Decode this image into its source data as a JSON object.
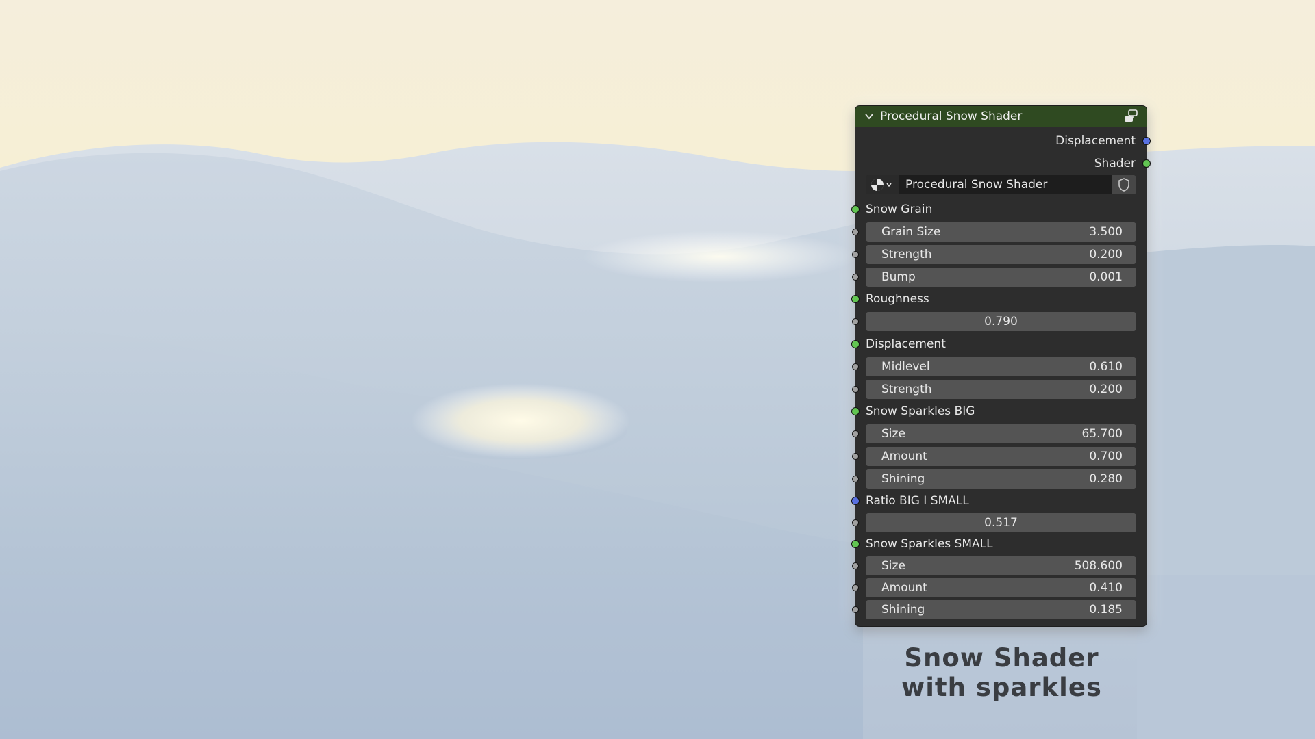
{
  "colors": {
    "header": "#2f4a21",
    "node_body": "#2d2d2d",
    "field": "#545454",
    "socket_green": "#62c552",
    "socket_blue": "#5870e0",
    "socket_grey": "#a1a1a1",
    "caption": "#3a3d42"
  },
  "node": {
    "title": "Procedural Snow Shader",
    "header_icons": [
      "chevron-down-icon",
      "node-group-icon"
    ],
    "outputs": [
      {
        "label": "Displacement",
        "socket": "blue"
      },
      {
        "label": "Shader",
        "socket": "green"
      }
    ],
    "group_selector": {
      "name": "Procedural Snow Shader",
      "icons": [
        "material-sphere-icon",
        "fake-user-shield-icon"
      ]
    },
    "sections": [
      {
        "label": "Snow Grain",
        "socket": "green",
        "fields": [
          {
            "label": "Grain Size",
            "value": "3.500"
          },
          {
            "label": "Strength",
            "value": "0.200"
          },
          {
            "label": "Bump",
            "value": "0.001"
          }
        ]
      },
      {
        "label": "Roughness",
        "socket": "green",
        "fields": [
          {
            "label": "",
            "value": "0.790"
          }
        ]
      },
      {
        "label": "Displacement",
        "socket": "green",
        "fields": [
          {
            "label": "Midlevel",
            "value": "0.610"
          },
          {
            "label": "Strength",
            "value": "0.200"
          }
        ]
      },
      {
        "label": "Snow Sparkles BIG",
        "socket": "green",
        "fields": [
          {
            "label": "Size",
            "value": "65.700"
          },
          {
            "label": "Amount",
            "value": "0.700"
          },
          {
            "label": "Shining",
            "value": "0.280"
          }
        ]
      },
      {
        "label": "Ratio BIG I SMALL",
        "socket": "blue",
        "fields": [
          {
            "label": "",
            "value": "0.517"
          }
        ]
      },
      {
        "label": "Snow Sparkles SMALL",
        "socket": "green",
        "fields": [
          {
            "label": "Size",
            "value": "508.600"
          },
          {
            "label": "Amount",
            "value": "0.410"
          },
          {
            "label": "Shining",
            "value": "0.185"
          }
        ]
      }
    ]
  },
  "caption": {
    "line1": "Snow Shader",
    "line2": "with sparkles"
  }
}
